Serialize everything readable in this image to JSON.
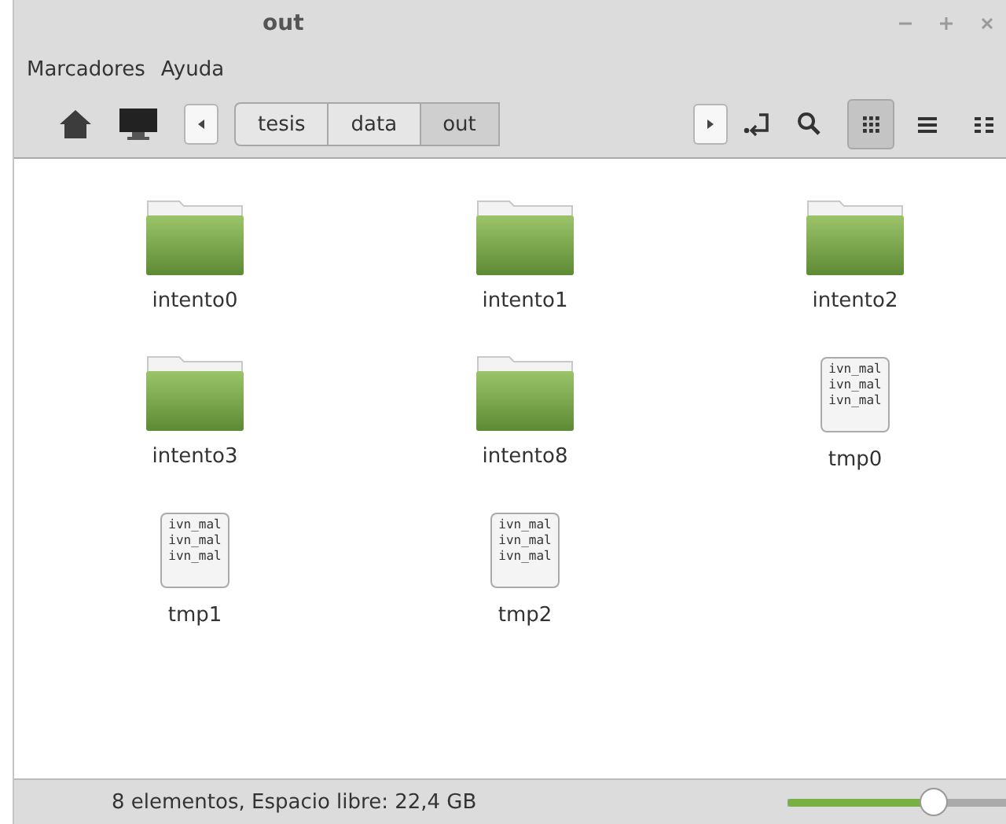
{
  "window": {
    "title": "out"
  },
  "menu": [
    "Marcadores",
    "Ayuda"
  ],
  "breadcrumb": [
    {
      "label": "tesis",
      "selected": false
    },
    {
      "label": "data",
      "selected": false
    },
    {
      "label": "out",
      "selected": true
    }
  ],
  "view_modes": [
    {
      "kind": "icons",
      "selected": true
    },
    {
      "kind": "list",
      "selected": false
    },
    {
      "kind": "compact",
      "selected": false
    }
  ],
  "files": [
    {
      "kind": "folder",
      "name": "intento0"
    },
    {
      "kind": "folder",
      "name": "intento1"
    },
    {
      "kind": "folder",
      "name": "intento2"
    },
    {
      "kind": "folder",
      "name": "intento3"
    },
    {
      "kind": "folder",
      "name": "intento8"
    },
    {
      "kind": "text",
      "name": "tmp0",
      "preview": [
        "ivn_mal",
        "ivn_mal",
        "ivn_mal"
      ]
    },
    {
      "kind": "text",
      "name": "tmp1",
      "preview": [
        "ivn_mal",
        "ivn_mal",
        "ivn_mal"
      ]
    },
    {
      "kind": "text",
      "name": "tmp2",
      "preview": [
        "ivn_mal",
        "ivn_mal",
        "ivn_mal"
      ]
    }
  ],
  "status_bar": {
    "text": "8 elementos, Espacio libre: 22,4 GB",
    "zoom": {
      "level": 0.58
    }
  }
}
